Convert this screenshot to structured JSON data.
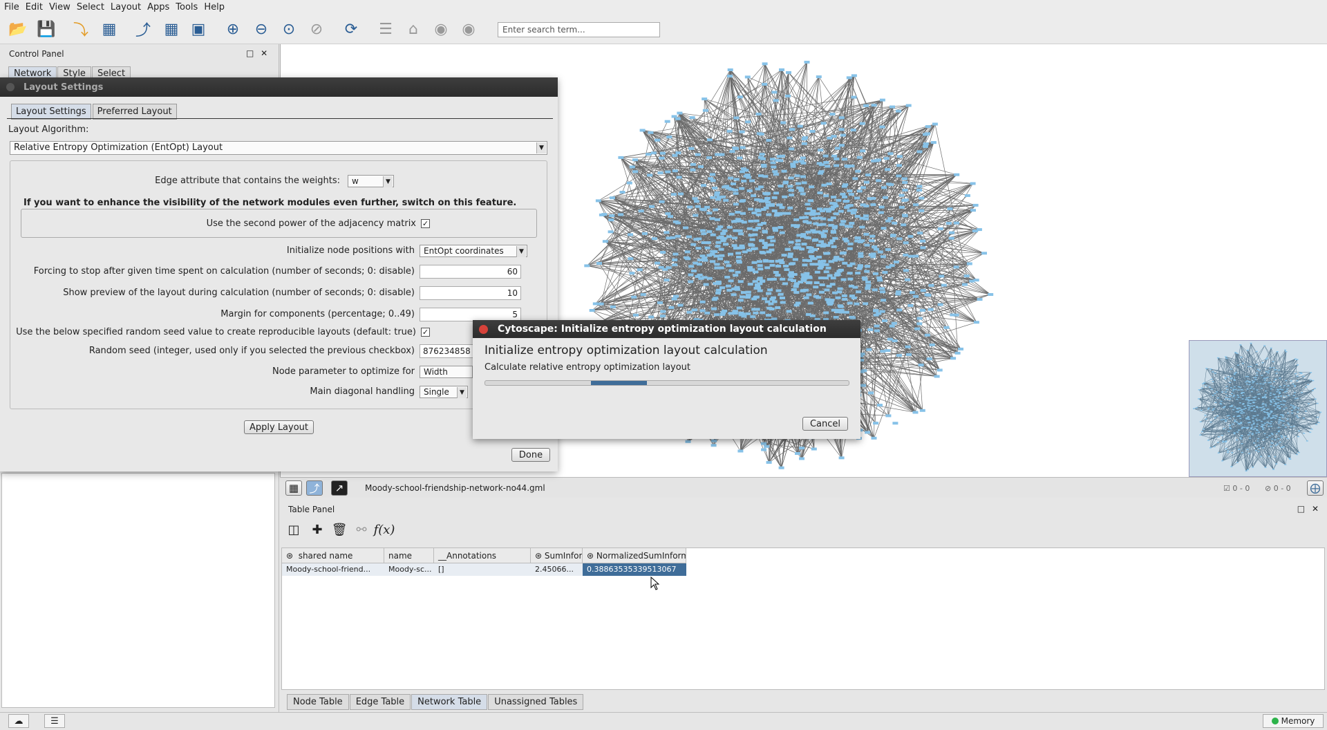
{
  "menu": [
    "File",
    "Edit",
    "View",
    "Select",
    "Layout",
    "Apps",
    "Tools",
    "Help"
  ],
  "toolbar": {
    "icons": [
      "open-session-icon",
      "save-session-icon",
      "import-network-icon",
      "import-table-icon",
      "export-network-icon",
      "export-table-icon",
      "export-image-icon",
      "zoom-in-icon",
      "zoom-out-icon",
      "zoom-fit-icon",
      "zoom-selected-icon",
      "refresh-icon",
      "new-from-selection-icon",
      "home-icon",
      "hide-icon",
      "show-icon"
    ],
    "search_placeholder": "Enter search term..."
  },
  "control_panel": {
    "title": "Control Panel",
    "tabs": [
      "Network",
      "Style",
      "Select"
    ]
  },
  "layout_dialog": {
    "title": "Layout Settings",
    "tabs": [
      "Layout Settings",
      "Preferred Layout"
    ],
    "algorithm_label": "Layout Algorithm:",
    "algorithm_value": "Relative Entropy Optimization (EntOpt) Layout",
    "edge_attr_label": "Edge attribute that contains the weights:",
    "edge_attr_value": "w",
    "hint": "If you want to enhance the visibility of the network modules even further, switch on this feature.",
    "second_power_label": "Use the second power of the adjacency matrix",
    "init_label": "Initialize node positions with",
    "init_value": "EntOpt coordinates",
    "stop_label": "Forcing to stop after given time spent on calculation (number of seconds; 0: disable)",
    "stop_value": "60",
    "preview_label": "Show preview of the layout during calculation (number of seconds; 0: disable)",
    "preview_value": "10",
    "margin_label": "Margin for components (percentage; 0..49)",
    "margin_value": "5",
    "seed_check_label": "Use the below specified random seed value to create reproducible layouts (default: true)",
    "seed_label": "Random seed (integer, used only if you selected the previous checkbox)",
    "seed_value": "876234858",
    "node_param_label": "Node parameter to optimize for",
    "node_param_value": "Width",
    "diagonal_label": "Main diagonal handling",
    "diagonal_value": "Single",
    "apply_button": "Apply Layout",
    "done_button": "Done"
  },
  "progress_dialog": {
    "title": "Cytoscape: Initialize entropy optimization layout calculation",
    "heading": "Initialize entropy optimization layout calculation",
    "subtitle": "Calculate relative entropy optimization layout",
    "cancel_button": "Cancel",
    "progress_start": 0.29,
    "progress_end": 0.445
  },
  "network_view": {
    "network_name": "Moody-school-friendship-network-no44.gml",
    "selected_nodes": "0 - 0",
    "hidden_nodes": "0 - 0",
    "node_color": "#87c2e8",
    "edge_color": "#6b6b6b"
  },
  "table_panel": {
    "title": "Table Panel",
    "columns": [
      "shared name",
      "name",
      "__Annotations",
      "SumInfor",
      "NormalizedSumInform"
    ],
    "row": [
      "Moody-school-friend...",
      "Moody-sc...",
      "[]",
      "2.45066...",
      "0.38863535339513067"
    ],
    "tabs": [
      "Node Table",
      "Edge Table",
      "Network Table",
      "Unassigned Tables"
    ],
    "active_tab": "Network Table"
  },
  "status_bar": {
    "memory_label": "Memory"
  }
}
